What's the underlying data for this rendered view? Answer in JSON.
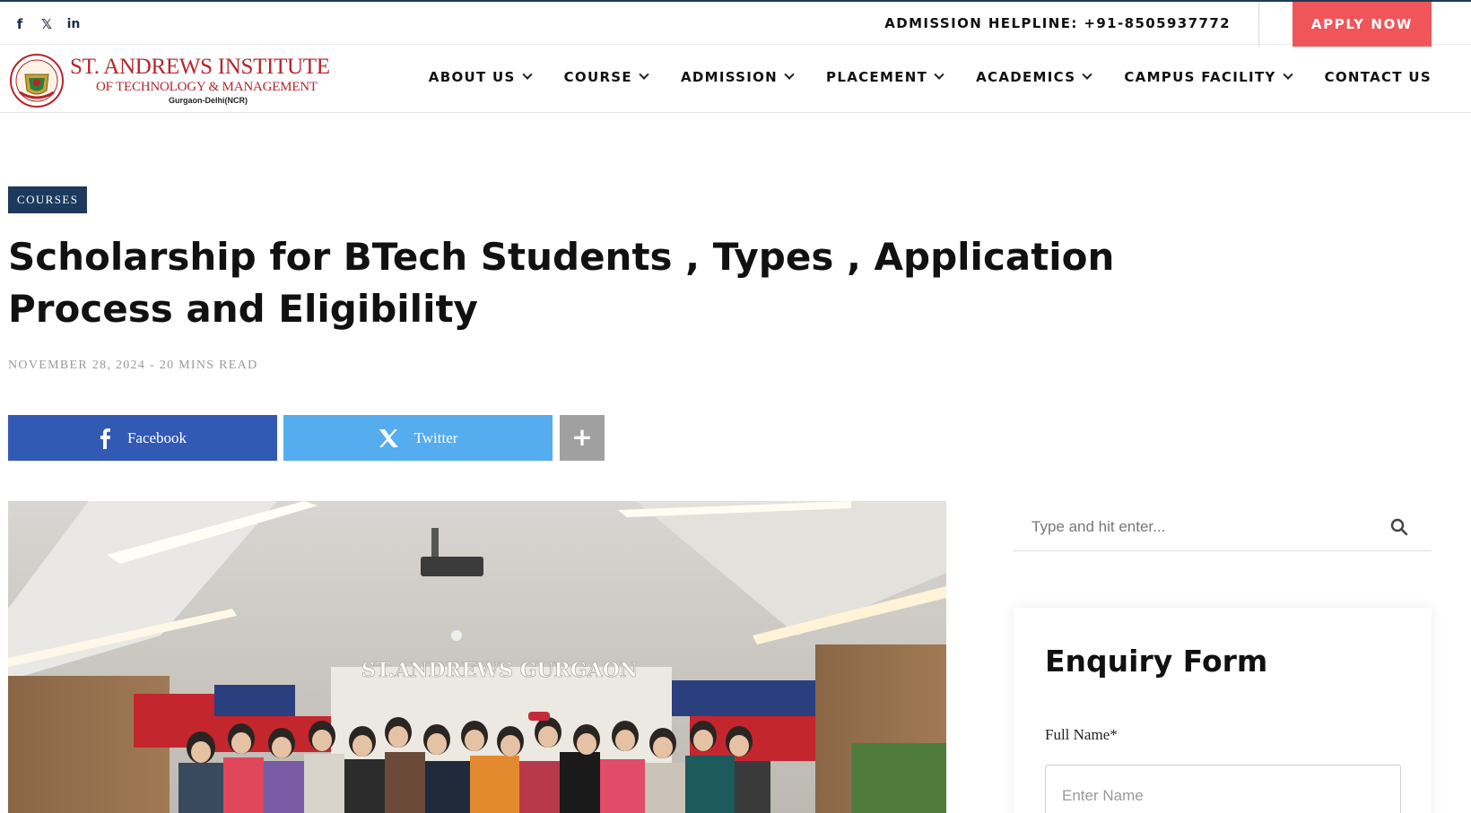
{
  "topbar": {
    "social": [
      {
        "icon": "facebook-icon",
        "glyph": "f"
      },
      {
        "icon": "x-icon",
        "glyph": "𝕏"
      },
      {
        "icon": "linkedin-icon",
        "glyph": "in"
      }
    ],
    "helpline": "ADMISSION HELPLINE: +91-8505937772",
    "apply_label": "APPLY NOW"
  },
  "logo": {
    "line1": "ST. ANDREWS INSTITUTE",
    "line2": "OF TECHNOLOGY & MANAGEMENT",
    "line3": "Gurgaon-Delhi(NCR)"
  },
  "nav": [
    {
      "label": "ABOUT US",
      "dropdown": true
    },
    {
      "label": "COURSE",
      "dropdown": true
    },
    {
      "label": "ADMISSION",
      "dropdown": true
    },
    {
      "label": "PLACEMENT",
      "dropdown": true
    },
    {
      "label": "ACADEMICS",
      "dropdown": true
    },
    {
      "label": "CAMPUS FACILITY",
      "dropdown": true
    },
    {
      "label": "CONTACT US",
      "dropdown": false
    }
  ],
  "article": {
    "category": "COURSES",
    "title": "Scholarship for BTech Students , Types , Application Process and Eligibility",
    "date": "NOVEMBER 28, 2024",
    "separator": "-",
    "read_time": "20 MINS READ"
  },
  "share": {
    "facebook": "Facebook",
    "twitter": "Twitter",
    "more": "+"
  },
  "photo": {
    "sign": "ST.ANDREWS  GURGAON"
  },
  "sidebar": {
    "search_placeholder": "Type and hit enter...",
    "form_title": "Enquiry Form",
    "full_name_label": "Full Name*",
    "full_name_placeholder": "Enter Name"
  },
  "colors": {
    "accent_red": "#f0555a",
    "navy": "#1c3a5e",
    "facebook": "#3259b4",
    "twitter": "#55acee"
  }
}
